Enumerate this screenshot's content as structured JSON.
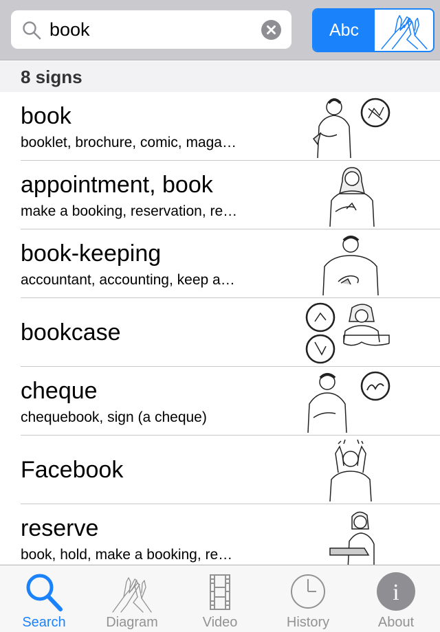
{
  "search": {
    "query": "book",
    "placeholder": ""
  },
  "mode_toggle": {
    "text_label": "Abc",
    "active": "text"
  },
  "result_count": "8 signs",
  "results": [
    {
      "title": "book",
      "subtitle": "booklet, brochure, comic, maga…"
    },
    {
      "title": "appointment, book",
      "subtitle": "make a booking, reservation, re…"
    },
    {
      "title": "book-keeping",
      "subtitle": "accountant, accounting, keep a…"
    },
    {
      "title": "bookcase",
      "subtitle": ""
    },
    {
      "title": "cheque",
      "subtitle": "chequebook, sign (a cheque)"
    },
    {
      "title": "Facebook",
      "subtitle": ""
    },
    {
      "title": "reserve",
      "subtitle": "book, hold, make a booking, re…"
    }
  ],
  "tabs": [
    {
      "label": "Search",
      "icon": "search-icon",
      "active": true
    },
    {
      "label": "Diagram",
      "icon": "hands-icon",
      "active": false
    },
    {
      "label": "Video",
      "icon": "film-icon",
      "active": false
    },
    {
      "label": "History",
      "icon": "clock-icon",
      "active": false
    },
    {
      "label": "About",
      "icon": "info-icon",
      "active": false
    }
  ],
  "colors": {
    "accent": "#1a82fb",
    "header_bg": "#c9c9ce",
    "tab_inactive": "#929292"
  }
}
